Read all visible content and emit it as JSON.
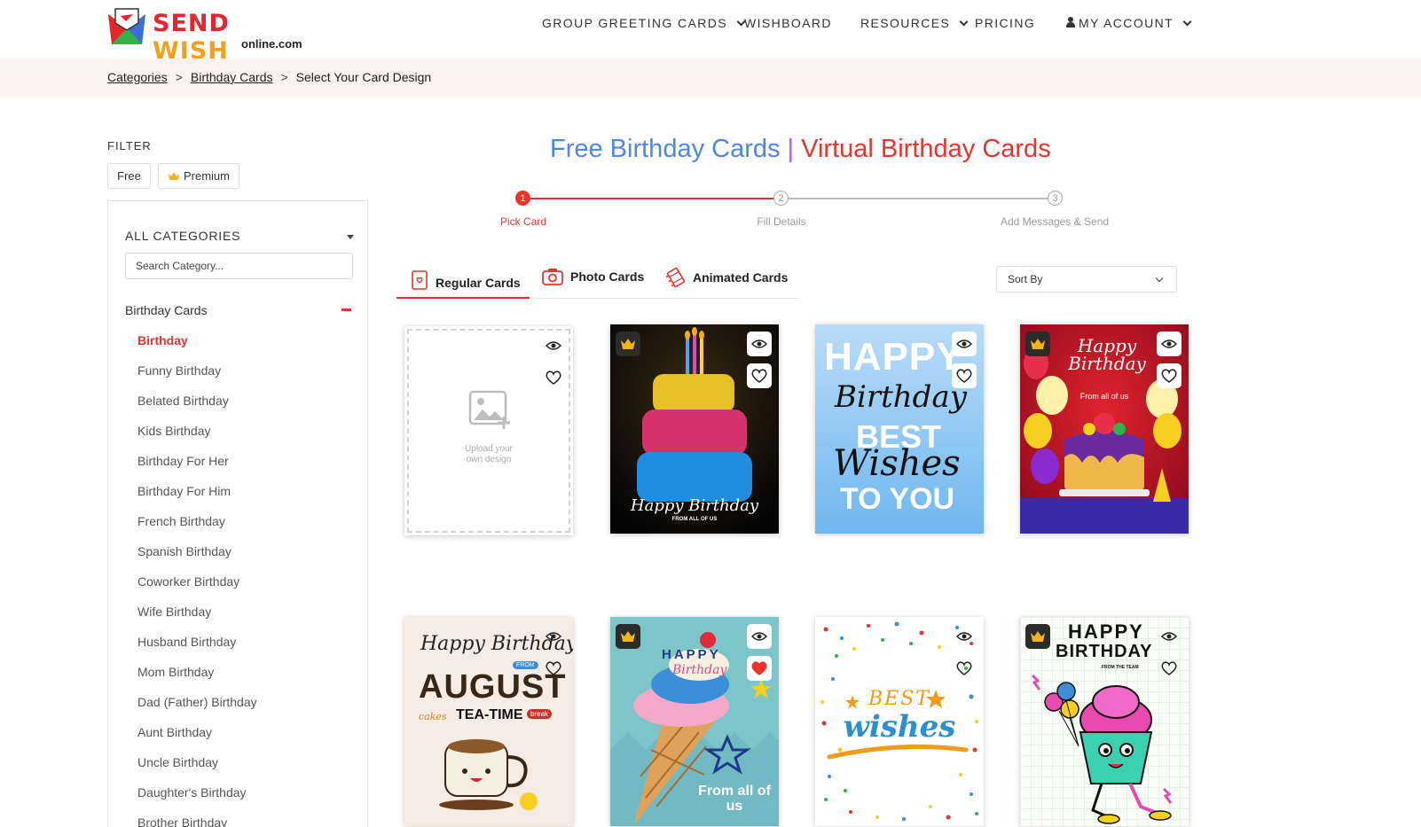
{
  "brand": {
    "name_part1": "SEND",
    "name_part2": "WISH",
    "domain": "online.com",
    "colors": {
      "red": "#e8242c",
      "orange": "#f3a01b"
    }
  },
  "nav": {
    "items": [
      {
        "label": "GROUP GREETING CARDS",
        "has_dropdown": true
      },
      {
        "label": "WISHBOARD",
        "has_dropdown": false
      },
      {
        "label": "RESOURCES",
        "has_dropdown": true
      },
      {
        "label": "PRICING",
        "has_dropdown": false
      },
      {
        "label": "MY ACCOUNT",
        "has_dropdown": true,
        "icon": "user-icon"
      }
    ]
  },
  "breadcrumb": {
    "items": [
      "Categories",
      "Birthday Cards"
    ],
    "current": "Select Your Card Design",
    "separator": ">"
  },
  "filter": {
    "label": "FILTER",
    "buttons": [
      {
        "label": "Free"
      },
      {
        "label": "Premium",
        "icon": "crown-icon"
      }
    ]
  },
  "sidebar": {
    "title": "ALL CATEGORIES",
    "search_placeholder": "Search Category...",
    "group_label": "Birthday Cards",
    "items": [
      {
        "label": "Birthday",
        "active": true
      },
      {
        "label": "Funny Birthday"
      },
      {
        "label": "Belated Birthday"
      },
      {
        "label": "Kids Birthday"
      },
      {
        "label": "Birthday For Her"
      },
      {
        "label": "Birthday For Him"
      },
      {
        "label": "French Birthday"
      },
      {
        "label": "Spanish Birthday"
      },
      {
        "label": "Coworker Birthday"
      },
      {
        "label": "Wife Birthday"
      },
      {
        "label": "Husband Birthday"
      },
      {
        "label": "Mom Birthday"
      },
      {
        "label": "Dad (Father) Birthday"
      },
      {
        "label": "Aunt Birthday"
      },
      {
        "label": "Uncle Birthday"
      },
      {
        "label": "Daughter's Birthday"
      },
      {
        "label": "Brother Birthday"
      }
    ]
  },
  "main": {
    "title_part1": "Free Birthday Cards",
    "title_sep": " | ",
    "title_part2": "Virtual Birthday Cards",
    "steps": [
      {
        "number": "1",
        "label": "Pick Card",
        "active": true
      },
      {
        "number": "2",
        "label": "Fill Details",
        "active": false
      },
      {
        "number": "3",
        "label": "Add Messages & Send",
        "active": false
      }
    ],
    "tabs": [
      {
        "label": "Regular Cards",
        "icon": "card-icon",
        "active": true
      },
      {
        "label": "Photo Cards",
        "icon": "camera-icon",
        "active": false
      },
      {
        "label": "Animated Cards",
        "icon": "film-icon",
        "active": false
      }
    ],
    "sort_label": "Sort By",
    "accent_color": "#e8342c"
  },
  "cards": [
    {
      "type": "upload",
      "text": "Upload your own design",
      "premium": false,
      "favorited": false
    },
    {
      "type": "design",
      "theme": "glitter-cake",
      "text_line1": "Happy Birthday",
      "text_line2": "FROM ALL OF US",
      "premium": true,
      "favorited": false
    },
    {
      "type": "design",
      "theme": "blue-typography",
      "text_line1": "HAPPY",
      "text_line2": "Birthday",
      "text_line3": "BEST",
      "text_line4": "Wishes",
      "text_line5": "TO YOU",
      "premium": false,
      "favorited": false
    },
    {
      "type": "design",
      "theme": "red-balloons-cake",
      "text_line1": "Happy Birthday",
      "text_line2": "From all of us",
      "premium": true,
      "favorited": false
    },
    {
      "type": "design",
      "theme": "tea-time",
      "text_line1": "Happy Birthday",
      "text_line2": "FROM",
      "text_line3": "AUGUST",
      "text_line4": "cakes",
      "text_line5": "TEA-TIME",
      "text_line6": "break",
      "premium": false,
      "favorited": false
    },
    {
      "type": "design",
      "theme": "ice-cream",
      "text_line1": "HAPPY",
      "text_line2": "Birthday",
      "text_line3": "From all of us",
      "premium": true,
      "favorited": true
    },
    {
      "type": "design",
      "theme": "confetti",
      "text_line1": "BEST",
      "text_line2": "wishes",
      "premium": false,
      "favorited": false
    },
    {
      "type": "design",
      "theme": "cupcake-sketch",
      "text_line1": "HAPPY",
      "text_line2": "BIRTHDAY",
      "text_line3": "FROM THE TEAM",
      "premium": true,
      "favorited": false
    }
  ]
}
